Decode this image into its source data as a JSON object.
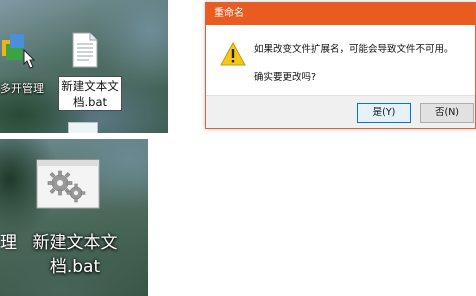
{
  "desktop_top": {
    "app_label": "多开管理",
    "file_icon": "text-file-icon",
    "rename_field": {
      "line1": "新建文本文",
      "line2": "档.bat"
    }
  },
  "dialog": {
    "title": "重命名",
    "icon": "warning-icon",
    "message": "如果改变文件扩展名，可能会导致文件不可用。",
    "question": "确实要更改吗?",
    "yes_label": "是(Y)",
    "no_label": "否(N)",
    "title_bar_color": "#ea5b20"
  },
  "desktop_bottom": {
    "left_fragment": "理",
    "file_icon": "batch-file-gears-icon",
    "file_label_line1": "新建文本文",
    "file_label_line2": "档.bat"
  }
}
